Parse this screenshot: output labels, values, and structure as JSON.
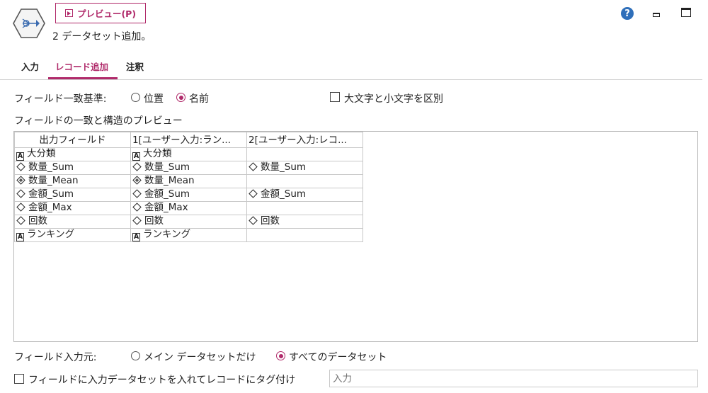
{
  "header": {
    "preview_label": "プレビュー(P)",
    "subtitle": "2 データセット追加。"
  },
  "window": {
    "help_glyph": "?"
  },
  "tabs": [
    {
      "label": "入力"
    },
    {
      "label": "レコード追加"
    },
    {
      "label": "注釈"
    }
  ],
  "field_match": {
    "label": "フィールド一致基準:",
    "options": [
      {
        "label": "位置"
      },
      {
        "label": "名前"
      }
    ],
    "selected": "名前",
    "case_sensitive_label": "大文字と小文字を区別",
    "case_sensitive_checked": false
  },
  "preview_section": {
    "title": "フィールドの一致と構造のプレビュー",
    "columns": [
      "出力フィールド",
      "1[ユーザー入力:ラン...",
      "2[ユーザー入力:レコ..."
    ],
    "rows": [
      [
        {
          "icon": "A",
          "text": "大分類"
        },
        {
          "icon": "A",
          "text": "大分類"
        },
        {
          "icon": "",
          "text": ""
        }
      ],
      [
        {
          "icon": "diamond",
          "text": "数量_Sum"
        },
        {
          "icon": "diamond",
          "text": "数量_Sum"
        },
        {
          "icon": "diamond",
          "text": "数量_Sum"
        }
      ],
      [
        {
          "icon": "diamond-filled",
          "text": "数量_Mean"
        },
        {
          "icon": "diamond-filled",
          "text": "数量_Mean"
        },
        {
          "icon": "",
          "text": ""
        }
      ],
      [
        {
          "icon": "diamond",
          "text": "金額_Sum"
        },
        {
          "icon": "diamond",
          "text": "金額_Sum"
        },
        {
          "icon": "diamond",
          "text": "金額_Sum"
        }
      ],
      [
        {
          "icon": "diamond",
          "text": "金額_Max"
        },
        {
          "icon": "diamond",
          "text": "金額_Max"
        },
        {
          "icon": "",
          "text": ""
        }
      ],
      [
        {
          "icon": "diamond",
          "text": "回数"
        },
        {
          "icon": "diamond",
          "text": "回数"
        },
        {
          "icon": "diamond",
          "text": "回数"
        }
      ],
      [
        {
          "icon": "A",
          "text": "ランキング"
        },
        {
          "icon": "A",
          "text": "ランキング"
        },
        {
          "icon": "",
          "text": ""
        }
      ]
    ]
  },
  "include_from": {
    "label": "フィールド入力元:",
    "options": [
      {
        "label": "メイン データセットだけ"
      },
      {
        "label": "すべてのデータセット"
      }
    ],
    "selected": "すべてのデータセット"
  },
  "tag": {
    "checkbox_label": "フィールドに入力データセットを入れてレコードにタグ付け",
    "checked": false,
    "placeholder": "入力"
  },
  "colors": {
    "accent": "#b02a6a",
    "help": "#2f6fba"
  }
}
